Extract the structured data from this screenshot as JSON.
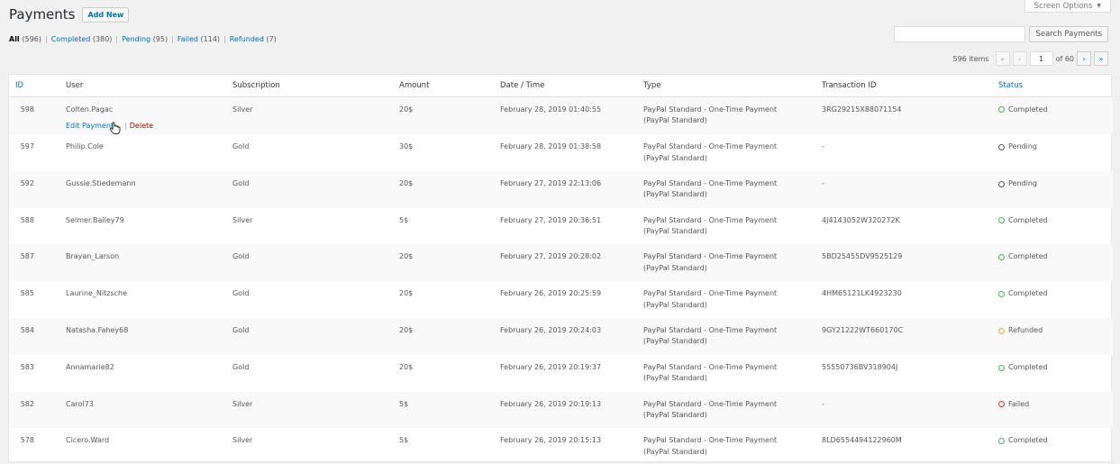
{
  "header": {
    "title": "Payments",
    "add_new": "Add New",
    "screen_options": "Screen Options"
  },
  "filters": {
    "all": {
      "label": "All",
      "count": "(596)"
    },
    "completed": {
      "label": "Completed",
      "count": "(380)"
    },
    "pending": {
      "label": "Pending",
      "count": "(95)"
    },
    "failed": {
      "label": "Failed",
      "count": "(114)"
    },
    "refunded": {
      "label": "Refunded",
      "count": "(7)"
    }
  },
  "search": {
    "placeholder": "",
    "button": "Search Payments"
  },
  "pagination": {
    "items": "596 items",
    "first": "«",
    "prev": "‹",
    "current_page": "1",
    "of_pages": "of 60",
    "next": "›",
    "last": "»"
  },
  "columns": [
    "ID",
    "User",
    "Subscription",
    "Amount",
    "Date / Time",
    "Type",
    "Transaction ID",
    "Status"
  ],
  "row_actions": {
    "edit": "Edit Payment",
    "delete": "Delete"
  },
  "status_colors": {
    "Completed": "#46b450",
    "Pending": "#555555",
    "Refunded": "#f0a832",
    "Failed": "#dc3232"
  },
  "rows": [
    {
      "id": "598",
      "user": "Colten.Pagac",
      "subscription": "Silver",
      "amount": "20$",
      "datetime": "February 28, 2019 01:40:55",
      "type1": "PayPal Standard - One-Time Payment",
      "type2": "(PayPal Standard)",
      "txn": "3RG29215X88071154",
      "status": "Completed"
    },
    {
      "id": "597",
      "user": "Philip.Cole",
      "subscription": "Gold",
      "amount": "30$",
      "datetime": "February 28, 2019 01:38:58",
      "type1": "PayPal Standard - One-Time Payment",
      "type2": "(PayPal Standard)",
      "txn": "-",
      "status": "Pending"
    },
    {
      "id": "592",
      "user": "Gussie.Stiedemann",
      "subscription": "Gold",
      "amount": "20$",
      "datetime": "February 27, 2019 22:13:06",
      "type1": "PayPal Standard - One-Time Payment",
      "type2": "(PayPal Standard)",
      "txn": "-",
      "status": "Pending"
    },
    {
      "id": "588",
      "user": "Selmer.Bailey79",
      "subscription": "Silver",
      "amount": "5$",
      "datetime": "February 27, 2019 20:36:51",
      "type1": "PayPal Standard - One-Time Payment",
      "type2": "(PayPal Standard)",
      "txn": "4J4143052W320272K",
      "status": "Completed"
    },
    {
      "id": "587",
      "user": "Brayan_Larson",
      "subscription": "Gold",
      "amount": "20$",
      "datetime": "February 27, 2019 20:28:02",
      "type1": "PayPal Standard - One-Time Payment",
      "type2": "(PayPal Standard)",
      "txn": "5BD25455DV9525129",
      "status": "Completed"
    },
    {
      "id": "585",
      "user": "Laurine_Nitzsche",
      "subscription": "Gold",
      "amount": "20$",
      "datetime": "February 26, 2019 20:25:59",
      "type1": "PayPal Standard - One-Time Payment",
      "type2": "(PayPal Standard)",
      "txn": "4HM65121LK4923230",
      "status": "Completed"
    },
    {
      "id": "584",
      "user": "Natasha.Fahey68",
      "subscription": "Gold",
      "amount": "20$",
      "datetime": "February 26, 2019 20:24:03",
      "type1": "PayPal Standard - One-Time Payment",
      "type2": "(PayPal Standard)",
      "txn": "9GY21222WT660170C",
      "status": "Refunded"
    },
    {
      "id": "583",
      "user": "Annamarie82",
      "subscription": "Gold",
      "amount": "20$",
      "datetime": "February 26, 2019 20:19:37",
      "type1": "PayPal Standard - One-Time Payment",
      "type2": "(PayPal Standard)",
      "txn": "55550736BV318904J",
      "status": "Completed"
    },
    {
      "id": "582",
      "user": "Carol73",
      "subscription": "Silver",
      "amount": "5$",
      "datetime": "February 26, 2019 20:19:13",
      "type1": "PayPal Standard - One-Time Payment",
      "type2": "(PayPal Standard)",
      "txn": "-",
      "status": "Failed"
    },
    {
      "id": "578",
      "user": "Cicero.Ward",
      "subscription": "Silver",
      "amount": "5$",
      "datetime": "February 26, 2019 20:15:13",
      "type1": "PayPal Standard - One-Time Payment",
      "type2": "(PayPal Standard)",
      "txn": "8LD6554494122960M",
      "status": "Completed"
    }
  ]
}
